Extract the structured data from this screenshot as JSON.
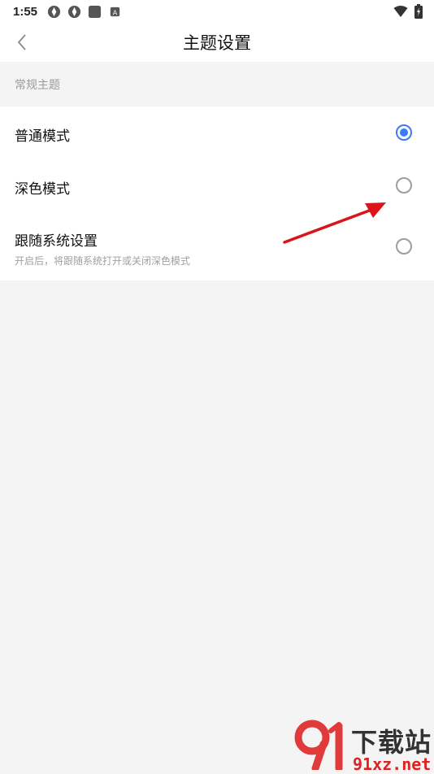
{
  "status_bar": {
    "time": "1:55",
    "left_icons": [
      "app-notification-icon",
      "app-notification-icon",
      "square-notification-icon",
      "a-badge-icon"
    ],
    "right_icons": [
      "wifi-icon",
      "battery-charging-icon"
    ]
  },
  "app_bar": {
    "back_icon": "chevron-left-icon",
    "title": "主题设置"
  },
  "section": {
    "label": "常规主题"
  },
  "options": [
    {
      "label": "普通模式",
      "selected": true
    },
    {
      "label": "深色模式",
      "selected": false
    },
    {
      "label": "跟随系统设置",
      "description": "开启后，将跟随系统打开或关闭深色模式",
      "selected": false
    }
  ],
  "colors": {
    "accent": "#3a7bf6",
    "background": "#f4f4f4",
    "surface": "#ffffff",
    "arrow": "#d9151b"
  },
  "watermark": {
    "brand_text": "下载站",
    "site_text": "91xz.net"
  }
}
